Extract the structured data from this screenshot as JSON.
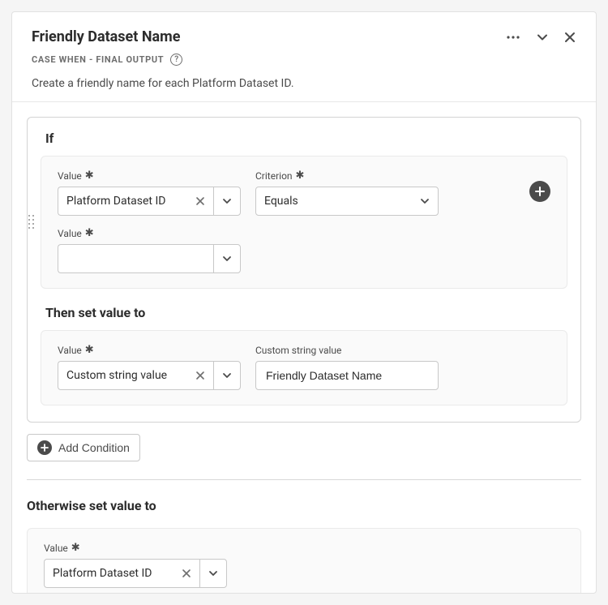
{
  "header": {
    "title": "Friendly Dataset Name",
    "subtitle": "CASE WHEN - FINAL OUTPUT",
    "description": "Create a friendly name for each Platform Dataset ID."
  },
  "if_section": {
    "title": "If",
    "value1_label": "Value",
    "value1": "Platform Dataset ID",
    "criterion_label": "Criterion",
    "criterion": "Equals",
    "value2_label": "Value",
    "value2": ""
  },
  "then_section": {
    "title": "Then set value to",
    "value_label": "Value",
    "value": "Custom string value",
    "custom_label": "Custom string value",
    "custom_value": "Friendly Dataset Name"
  },
  "add_condition_label": "Add Condition",
  "otherwise_section": {
    "title": "Otherwise set value to",
    "value_label": "Value",
    "value": "Platform Dataset ID"
  }
}
